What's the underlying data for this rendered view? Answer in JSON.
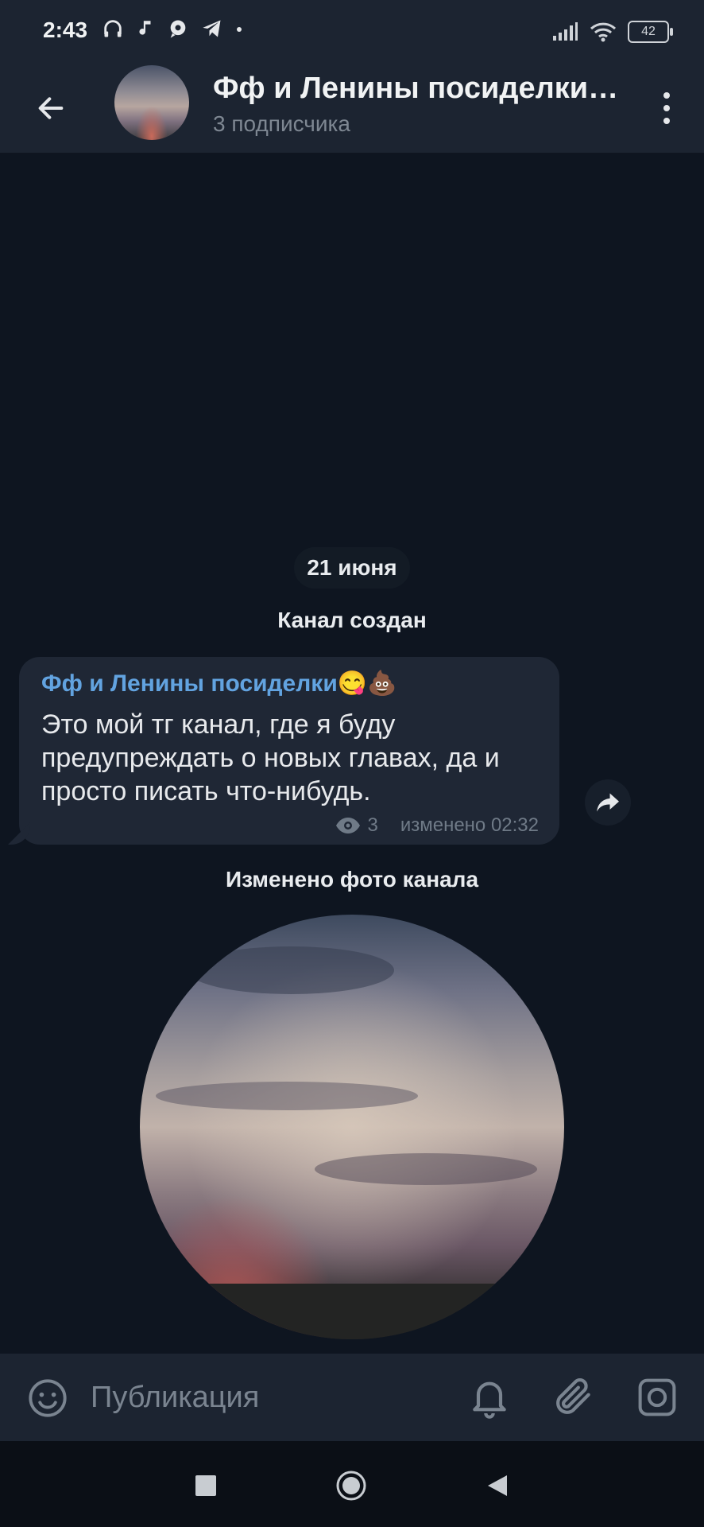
{
  "status_bar": {
    "time": "2:43",
    "battery": "42",
    "icons": [
      "headphones-icon",
      "music-note-icon",
      "chat-bubble-icon",
      "telegram-icon",
      "dot-icon",
      "signal-icon",
      "wifi-icon",
      "battery-icon"
    ]
  },
  "header": {
    "title": "Фф и Ленины посиделки…",
    "subtitle": "3 подписчика"
  },
  "chat": {
    "date": "21 июня",
    "service_created": "Канал создан",
    "service_photo_changed": "Изменено фото канала",
    "message": {
      "author": "Фф и Ленины посиделки😋💩",
      "text": "Это мой тг канал, где я буду предупреждать о новых главах, да и просто писать что-нибудь.",
      "views": "3",
      "edited": "изменено 02:32"
    }
  },
  "input": {
    "placeholder": "Публикация"
  },
  "colors": {
    "background": "#0e1520",
    "bar": "#1c2431",
    "bubble": "#1f2735",
    "accent": "#62a3e0"
  }
}
